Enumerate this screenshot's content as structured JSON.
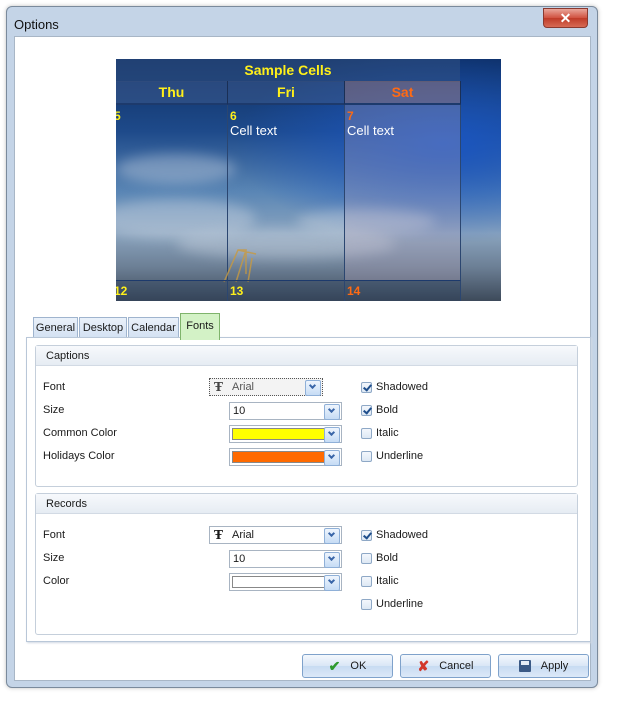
{
  "window": {
    "title": "Options",
    "close_icon": "✕"
  },
  "preview": {
    "header_title": "Sample Cells",
    "days": [
      {
        "name": "Thu",
        "color": "#fff01a"
      },
      {
        "name": "Fri",
        "color": "#fff01a"
      },
      {
        "name": "Sat",
        "color": "#ff6a13"
      }
    ],
    "cells": [
      {
        "num": "5",
        "text": "",
        "num_color": "#fff01a"
      },
      {
        "num": "6",
        "text": "Cell text",
        "num_color": "#fff01a"
      },
      {
        "num": "7",
        "text": "Cell text",
        "num_color": "#ff6a13"
      }
    ],
    "next_row": [
      {
        "num": "12",
        "num_color": "#fff01a"
      },
      {
        "num": "13",
        "num_color": "#fff01a"
      },
      {
        "num": "14",
        "num_color": "#ff6a13"
      }
    ]
  },
  "tabs": [
    {
      "label": "General",
      "active": false
    },
    {
      "label": "Desktop",
      "active": false
    },
    {
      "label": "Calendar",
      "active": false
    },
    {
      "label": "Fonts",
      "active": true
    }
  ],
  "captions": {
    "title": "Captions",
    "font_label": "Font",
    "font_value": "Arial",
    "size_label": "Size",
    "size_value": "10",
    "common_color_label": "Common Color",
    "common_color": "#ffff00",
    "holidays_color_label": "Holidays Color",
    "holidays_color": "#ff6a00",
    "options": [
      {
        "label": "Shadowed",
        "checked": true
      },
      {
        "label": "Bold",
        "checked": true
      },
      {
        "label": "Italic",
        "checked": false
      },
      {
        "label": "Underline",
        "checked": false
      }
    ]
  },
  "records": {
    "title": "Records",
    "font_label": "Font",
    "font_value": "Arial",
    "size_label": "Size",
    "size_value": "10",
    "color_label": "Color",
    "color": "#ffffff",
    "options": [
      {
        "label": "Shadowed",
        "checked": true
      },
      {
        "label": "Bold",
        "checked": false
      },
      {
        "label": "Italic",
        "checked": false
      },
      {
        "label": "Underline",
        "checked": false
      }
    ]
  },
  "buttons": {
    "ok": "OK",
    "cancel": "Cancel",
    "apply": "Apply"
  }
}
